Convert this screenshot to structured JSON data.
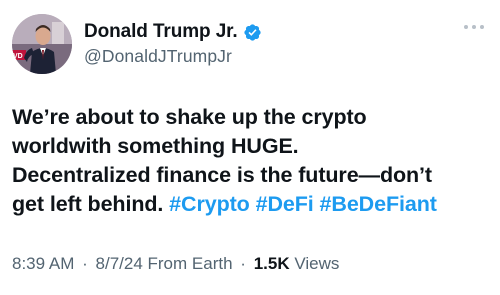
{
  "author": {
    "display_name": "Donald Trump Jr.",
    "handle": "@DonaldJTrumpJr",
    "verified_icon": "verified-badge-icon",
    "avatar_badge_text": "VD"
  },
  "tweet": {
    "lines": [
      {
        "text": "We’re about to shake up the crypto"
      },
      {
        "text": "worldwith something HUGE."
      },
      {
        "text": "Decentralized finance is the future—don’t"
      },
      {
        "text": "get left behind. "
      }
    ],
    "hashtags": [
      "#Crypto",
      "#DeFi",
      "#BeDeFiant"
    ]
  },
  "meta": {
    "time": "8:39 AM",
    "separator": "·",
    "date": "8/7/24",
    "source": "From Earth",
    "views_count": "1.5K",
    "views_label": "Views"
  },
  "colors": {
    "link": "#1d9bf0",
    "secondary_text": "#536471",
    "primary_text": "#0f1419",
    "verified": "#1d9bf0"
  },
  "icons": {
    "more": "more-options-icon"
  }
}
